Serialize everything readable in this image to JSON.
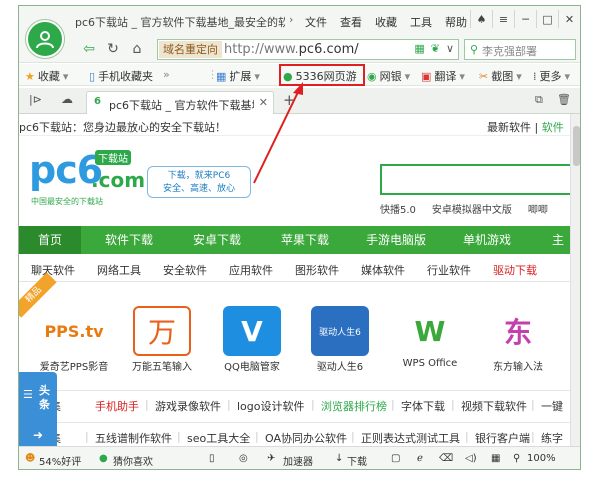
{
  "window": {
    "title": "pc6下载站 _ 官方软件下载基地_最安全的软",
    "menu": [
      "文件",
      "查看",
      "收藏",
      "工具",
      "帮助"
    ]
  },
  "addressbar": {
    "tag": "域名重定向",
    "url_prefix": "http://www.",
    "url_domain": "pc6.com/",
    "search_placeholder": "李克强部署"
  },
  "bookmarks": [
    {
      "label": "收藏",
      "icon": "star-icon"
    },
    {
      "label": "手机收藏夹",
      "icon": "phone-icon"
    },
    {
      "label": "扩展",
      "icon": "extension-icon"
    },
    {
      "label": "5336网页游",
      "icon": "game-icon"
    },
    {
      "label": "网银",
      "icon": "bank-icon"
    },
    {
      "label": "翻译",
      "icon": "translate-icon"
    },
    {
      "label": "截图",
      "icon": "scissors-icon"
    },
    {
      "label": "更多",
      "icon": "grid-icon"
    }
  ],
  "tab": {
    "favicon": "6",
    "title": "pc6下载站 _ 官方软件下载基地"
  },
  "page": {
    "top_left": "pc6下载站：您身边最放心的安全下载站！",
    "top_right_1": "最新软件",
    "top_right_2": "软件",
    "logo_text": "pc6",
    "logo_badge": "下载站",
    "logo_sub": ".com",
    "logo_tagline": "中国最安全的下载站",
    "slogan_1": "下载，就来PC6",
    "slogan_2": "安全、高速、放心",
    "hotlinks": [
      "快播5.0",
      "安卓模拟器中文版",
      "唧唧"
    ],
    "nav": [
      "首页",
      "软件下载",
      "安卓下载",
      "苹果下载",
      "手游电脑版",
      "单机游戏",
      "主"
    ],
    "subnav": [
      "聊天软件",
      "网络工具",
      "安全软件",
      "应用软件",
      "图形软件",
      "媒体软件",
      "行业软件",
      "驱动下载"
    ],
    "ribbon": "精品",
    "apps": [
      {
        "name": "爱奇艺PPS影音",
        "icon_text": "PPS.tv"
      },
      {
        "name": "万能五笔输入",
        "icon_text": "万"
      },
      {
        "name": "QQ电脑管家",
        "icon_text": "V"
      },
      {
        "name": "驱动人生6",
        "icon_text": "驱动人生6"
      },
      {
        "name": "WPS Office",
        "icon_text": "W"
      },
      {
        "name": "东方输入法",
        "icon_text": "东"
      }
    ],
    "tags1": [
      "合集",
      "手机助手",
      "游戏录像软件",
      "logo设计软件",
      "浏览器排行榜",
      "字体下载",
      "视频下载软件",
      "一键"
    ],
    "tags2": [
      "合集",
      "五线谱制作软件",
      "seo工具大全",
      "OA协同办公软件",
      "正则表达式测试工具",
      "银行客户端",
      "练字"
    ],
    "float_label_1": "头",
    "float_label_2": "条"
  },
  "statusbar": {
    "good_rate": "54%好评",
    "guess": "猜你喜欢",
    "accelerator": "加速器",
    "download": "下载",
    "zoom": "100%"
  },
  "colors": {
    "accent": "#2ea94a",
    "nav_green": "#3aa83a",
    "highlight_red": "#e02020"
  }
}
